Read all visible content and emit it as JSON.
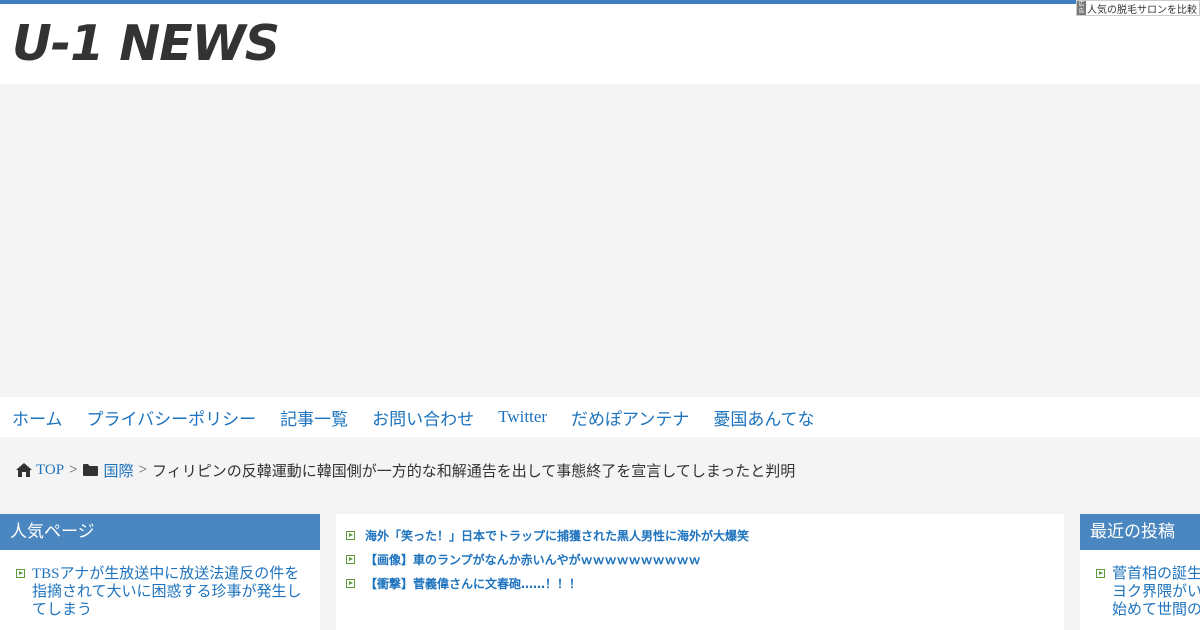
{
  "site": {
    "logo": "U-1 NEWS"
  },
  "ad_badge": {
    "icon_text": "広告",
    "label": "人気の脱毛サロンを比較"
  },
  "nav": {
    "items": [
      "ホーム",
      "プライバシーポリシー",
      "記事一覧",
      "お問い合わせ",
      "Twitter",
      "だめぽアンテナ",
      "憂国あんてな"
    ]
  },
  "breadcrumb": {
    "top": "TOP",
    "separator": ">",
    "category": "国際",
    "current": "フィリピンの反韓運動に韓国側が一方的な和解通告を出して事態終了を宣言してしまったと判明"
  },
  "popular": {
    "title": "人気ページ",
    "items": [
      "TBSアナが生放送中に放送法違反の件を指摘されて大いに困惑する珍事が発生してしまう"
    ]
  },
  "main": {
    "links": [
      "海外「笑った！」日本でトラップに捕獲された黒人男性に海外が大爆笑",
      "【画像】車のランプがなんか赤いんやがｗｗｗｗｗｗｗｗｗｗ",
      "【衝撃】菅義偉さんに文春砲……！！！"
    ]
  },
  "recent": {
    "title": "最近の投稿",
    "items": [
      "菅首相の誕生を阻止したサヨク界隈がいらしい工作を始めて世間の嘲笑の的に"
    ]
  },
  "colors": {
    "accent": "#3f7fbf",
    "link": "#1e73be",
    "widget_header": "#4a86bf",
    "bullet": "#5a9a3a"
  }
}
